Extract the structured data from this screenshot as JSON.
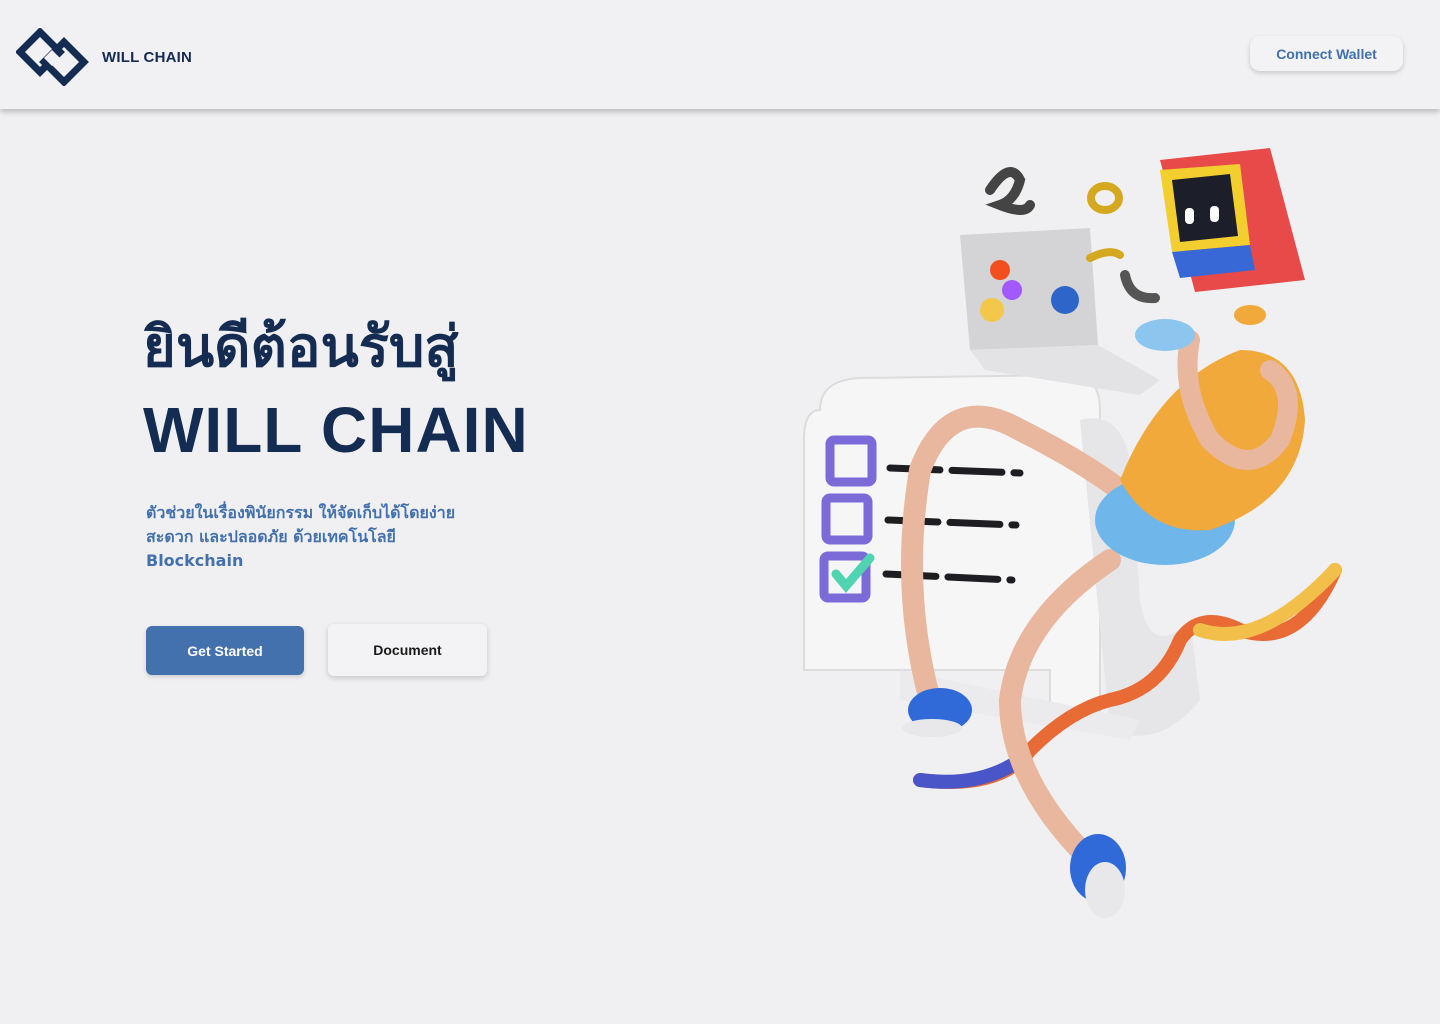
{
  "header": {
    "brand_name": "WILL CHAIN",
    "connect_label": "Connect Wallet"
  },
  "hero": {
    "title_line1": "ยินดีต้อนรับสู่",
    "title_line2": "WILL CHAIN",
    "subtitle_line1": "ตัวช่วยในเรื่องพินัยกรรม ให้จัดเก็บได้โดยง่าย",
    "subtitle_line2": "สะดวก และปลอดภัย ด้วยเทคโนโลยี",
    "subtitle_line3": "Blockchain",
    "primary_button": "Get Started",
    "secondary_button": "Document"
  },
  "colors": {
    "background": "#f0f0f2",
    "navy": "#142b52",
    "accent_blue": "#4371ae"
  },
  "icons": {
    "logo": "chain-link-diamond-logo-icon",
    "illustration": "3d-character-checklist-illustration"
  }
}
